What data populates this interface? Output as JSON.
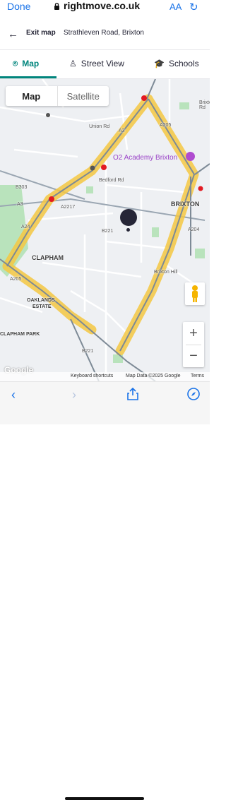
{
  "safari": {
    "done_label": "Done",
    "url": "rightmove.co.uk",
    "text_size_label": "AA"
  },
  "header": {
    "back_icon": "arrow-left-icon",
    "exit_label": "Exit map",
    "address": "Strathleven Road, Brixton"
  },
  "tabs": [
    {
      "label": "Map",
      "icon": "map-pin-icon",
      "active": true
    },
    {
      "label": "Street View",
      "icon": "street-view-icon",
      "active": false
    },
    {
      "label": "Schools",
      "icon": "graduation-cap-icon",
      "active": false
    }
  ],
  "map": {
    "type_toggle": {
      "map_label": "Map",
      "satellite_label": "Satellite"
    },
    "place_labels": {
      "brixton": "BRIXTON",
      "clapham": "CLAPHAM",
      "oakland_1": "OAKLANDS",
      "oakland_2": "ESTATE",
      "clapham_park": "CLAPHAM PARK",
      "o2_academy": "O2 Academy Brixton"
    },
    "road_labels": {
      "union_rd": "Union Rd",
      "a3_1": "A3",
      "a3_2": "A3",
      "b303": "B303",
      "a2217": "A2217",
      "bedford_rd": "Bedford Rd",
      "b221": "B221",
      "b221b": "B221",
      "a24": "A24",
      "a205": "A205",
      "a205b": "A205",
      "a204": "A204",
      "brixton_hill": "Brixton Hill",
      "brixton_rd": "Brixton Rd"
    },
    "zoom_in": "+",
    "zoom_out": "−",
    "logo": "Google",
    "attribution": {
      "shortcuts": "Keyboard shortcuts",
      "data": "Map Data ©2025 Google",
      "terms": "Terms"
    },
    "colors": {
      "highlight": "#f5c842",
      "green": "#b9e3bc",
      "water": "#aad3f5"
    }
  },
  "toolbar": {
    "icons": [
      "back-icon",
      "forward-icon",
      "share-icon",
      "compass-icon"
    ]
  }
}
